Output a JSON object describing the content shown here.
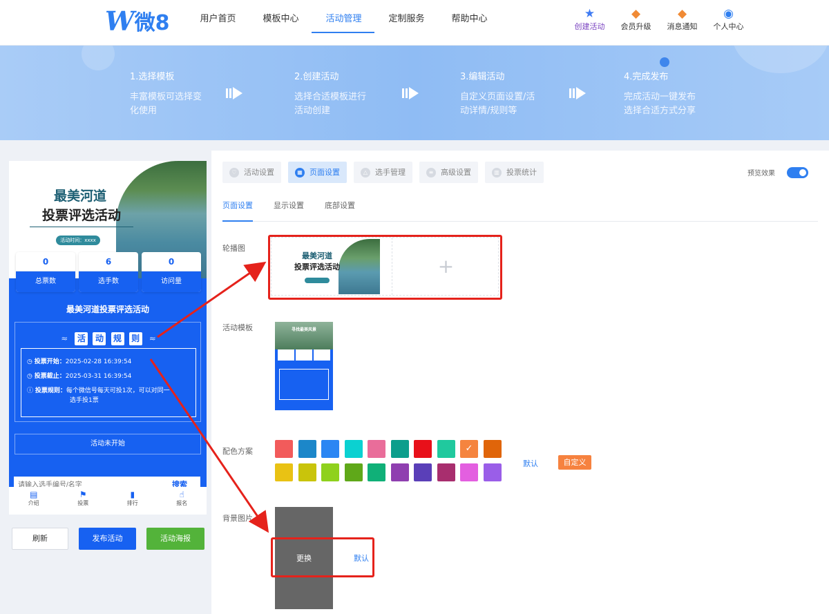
{
  "header": {
    "logo_mark": "W",
    "logo_text": "微8",
    "nav": [
      "用户首页",
      "模板中心",
      "活动管理",
      "定制服务",
      "帮助中心"
    ],
    "actions": {
      "create": "创建活动",
      "vip": "会员升级",
      "messages": "消息通知",
      "profile": "个人中心"
    }
  },
  "steps": [
    {
      "title": "1.选择模板",
      "desc": "丰富模板可选择变化使用"
    },
    {
      "title": "2.创建活动",
      "desc": "选择合适模板进行活动创建"
    },
    {
      "title": "3.编辑活动",
      "desc": "自定义页面设置/活动详情/规则等"
    },
    {
      "title": "4.完成发布",
      "desc": "完成活动一键发布选择合适方式分享"
    }
  ],
  "phone": {
    "cover_title_1": "最美河道",
    "cover_title_2": "投票评选活动",
    "cover_time": "活动时间：xxxx",
    "stats": [
      {
        "value": "0",
        "label": "总票数"
      },
      {
        "value": "6",
        "label": "选手数"
      },
      {
        "value": "0",
        "label": "访问量"
      }
    ],
    "activity_title": "最美河道投票评选活动",
    "rules_chars": [
      "活",
      "动",
      "规",
      "则"
    ],
    "rules": {
      "start_label": "投票开始：",
      "start_value": "2025-02-28 16:39:54",
      "end_label": "投票截止：",
      "end_value": "2025-03-31 16:39:54",
      "rule_label": "投票规则：",
      "rule_value_1": "每个微信号每天可投1次，可以对同一",
      "rule_value_2": "选手投1票"
    },
    "status": "活动未开始",
    "search_placeholder": "请输入选手编号/名字",
    "search_button": "搜索",
    "tabbar": [
      "介绍",
      "投票",
      "排行",
      "报名"
    ]
  },
  "buttons": {
    "refresh": "刷新",
    "publish": "发布活动",
    "poster": "活动海报"
  },
  "panel": {
    "tabs": [
      "活动设置",
      "页面设置",
      "选手管理",
      "高级设置",
      "投票统计"
    ],
    "active_tab": 1,
    "preview_label": "预览效果",
    "preview_on": true,
    "subtabs": [
      "页面设置",
      "显示设置",
      "底部设置"
    ],
    "carousel_label": "轮播图",
    "carousel_thumb_title_1": "最美河道",
    "carousel_thumb_title_2": "投票评选活动",
    "add_symbol": "+",
    "template_label": "活动模板",
    "template_caption": "寻找最美风景",
    "color_label": "配色方案",
    "colors_row1": [
      "#f25b5b",
      "#1c87c9",
      "#2b86f3",
      "#0bd1d1",
      "#e96d9a",
      "#0c9e8c",
      "#e8101a",
      "#20c99e",
      "#f5843f",
      "#e0650a"
    ],
    "colors_row2": [
      "#e9c214",
      "#c9c40b",
      "#8fd11d",
      "#5fa819",
      "#10b078",
      "#8f3fb0",
      "#5a3fb8",
      "#a82e6e",
      "#e35fe0",
      "#9a5ee8"
    ],
    "selected_color_index": 8,
    "color_default": "默认",
    "color_custom": "自定义",
    "bg_label": "背景图片",
    "bg_replace": "更换",
    "bg_default": "默认"
  }
}
